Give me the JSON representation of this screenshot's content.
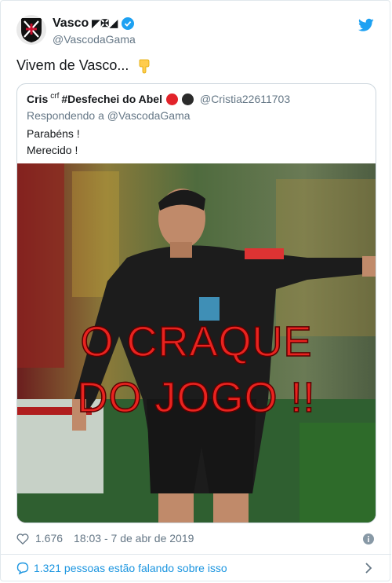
{
  "author": {
    "name": "Vasco",
    "badges": "◤✠◢",
    "handle": "@VascodaGama"
  },
  "tweet": {
    "text": "Vivem de Vasco...",
    "emoji": "point-down-hand"
  },
  "quoted": {
    "name": "Cris",
    "name_sup": "crf",
    "name_rest": "#Desfechei do Abel",
    "dots": [
      "#e2232a",
      "#2b2b2b"
    ],
    "handle": "@Cristia22611703",
    "reply": "Respondendo a @VascodaGama",
    "line1": "Parabéns !",
    "line2": "Merecido !",
    "image_text_line1": "O CRAQUE",
    "image_text_line2": "DO JOGO !!"
  },
  "footer": {
    "likes": "1.676",
    "timestamp": "18:03 - 7 de abr de 2019",
    "talking": "1.321 pessoas estão falando sobre isso"
  },
  "colors": {
    "accent": "#1b95e0",
    "twitter": "#1da1f2",
    "text": "#14171a",
    "secondary": "#657786"
  }
}
